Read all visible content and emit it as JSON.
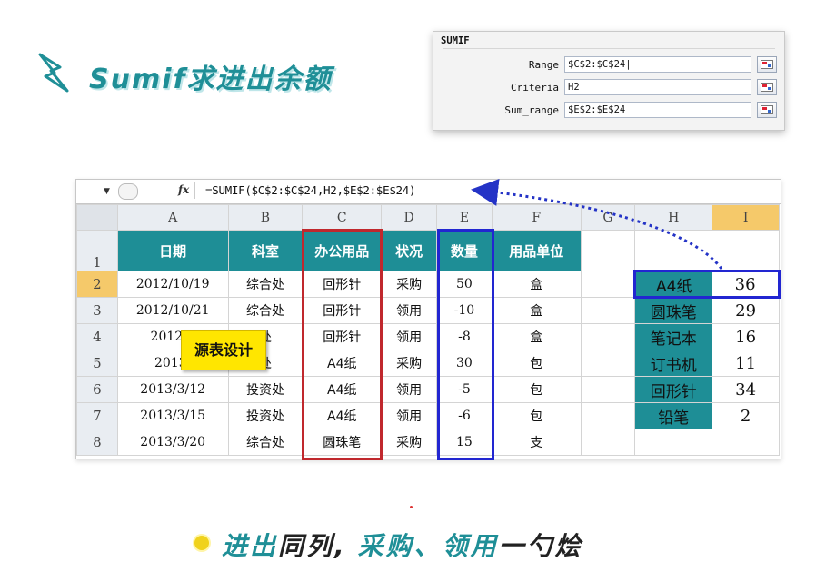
{
  "title": {
    "text": "Sumif求进出余额"
  },
  "dialog": {
    "title": "SUMIF",
    "fields": [
      {
        "label": "Range",
        "value": "$C$2:$C$24|"
      },
      {
        "label": "Criteria",
        "value": "H2"
      },
      {
        "label": "Sum_range",
        "value": "$E$2:$E$24"
      }
    ]
  },
  "formula_bar": {
    "fx": "fx",
    "formula": "=SUMIF($C$2:$C$24,H2,$E$2:$E$24)"
  },
  "columns": [
    "A",
    "B",
    "C",
    "D",
    "E",
    "F",
    "G",
    "H",
    "I"
  ],
  "rows": [
    "1",
    "2",
    "3",
    "4",
    "5",
    "6",
    "7",
    "8"
  ],
  "headers": [
    "日期",
    "科室",
    "办公用品",
    "状况",
    "数量",
    "用品单位"
  ],
  "data_rows": [
    [
      "2012/10/19",
      "综合处",
      "回形针",
      "采购",
      "50",
      "盒"
    ],
    [
      "2012/10/21",
      "综合处",
      "回形针",
      "领用",
      "-10",
      "盒"
    ],
    [
      "2012/1",
      "处",
      "回形针",
      "领用",
      "-8",
      "盒"
    ],
    [
      "2013/",
      "处",
      "A4纸",
      "采购",
      "30",
      "包"
    ],
    [
      "2013/3/12",
      "投资处",
      "A4纸",
      "领用",
      "-5",
      "包"
    ],
    [
      "2013/3/15",
      "投资处",
      "A4纸",
      "领用",
      "-6",
      "包"
    ],
    [
      "2013/3/20",
      "综合处",
      "圆珠笔",
      "采购",
      "15",
      "支"
    ]
  ],
  "lookup": [
    {
      "item": "A4纸",
      "total": "36"
    },
    {
      "item": "圆珠笔",
      "total": "29"
    },
    {
      "item": "笔记本",
      "total": "16"
    },
    {
      "item": "订书机",
      "total": "11"
    },
    {
      "item": "回形针",
      "total": "34"
    },
    {
      "item": "铅笔",
      "total": "2"
    }
  ],
  "sticky_note": "源表设计",
  "footer": {
    "part1": "进出",
    "part2": "同列,",
    "part3": "采购、领用",
    "part4": "一勺烩"
  },
  "colors": {
    "teal": "#1e8e96",
    "red_box": "#c0282d",
    "blue_box": "#2226d1",
    "selected_header": "#f5c96a",
    "sticky": "#ffe600"
  }
}
